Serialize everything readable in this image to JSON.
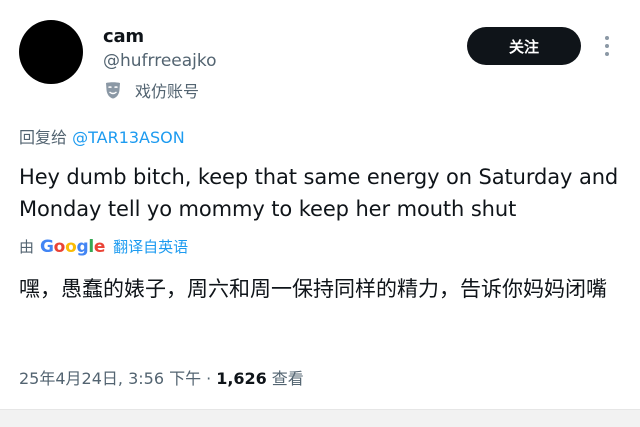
{
  "user": {
    "display_name": "cam",
    "handle": "@hufrreeajko",
    "parody_label": "戏仿账号",
    "follow_label": "关注"
  },
  "reply": {
    "prefix": "回复给 ",
    "target": "@TAR13ASON"
  },
  "tweet": {
    "text": "Hey dumb bitch, keep that same energy on Saturday and Monday tell yo mommy to keep her mouth shut"
  },
  "translation": {
    "by": "由",
    "google": [
      "G",
      "o",
      "o",
      "g",
      "l",
      "e"
    ],
    "action_label": "翻译自英语",
    "text": "嘿，愚蠢的婊子，周六和周一保持同样的精力，告诉你妈妈闭嘴"
  },
  "meta": {
    "timestamp": "25年4月24日, 3:56 下午",
    "separator": "·",
    "view_count": "1,626",
    "view_label": "查看"
  },
  "icons": {
    "avatar": "avatar",
    "parody": "parody-mask-icon",
    "more": "more-options-icon"
  },
  "colors": {
    "link": "#1d9bf0",
    "secondary_text": "#536471",
    "primary_text": "#0f1419",
    "follow_button_bg": "#0f1419"
  }
}
